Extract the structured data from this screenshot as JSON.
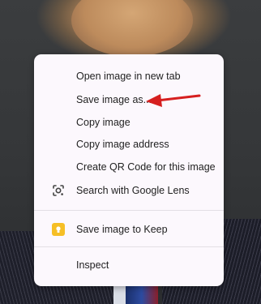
{
  "context_menu": {
    "items": [
      {
        "label": "Open image in new tab"
      },
      {
        "label": "Save image as..."
      },
      {
        "label": "Copy image"
      },
      {
        "label": "Copy image address"
      },
      {
        "label": "Create QR Code for this image"
      },
      {
        "label": "Search with Google Lens",
        "icon": "google-lens-icon"
      },
      {
        "label": "Save image to Keep",
        "icon": "google-keep-icon"
      },
      {
        "label": "Inspect"
      }
    ]
  },
  "annotation": {
    "arrow_color": "#d61f1f",
    "points_to": "Save image as..."
  },
  "colors": {
    "menu_background": "#fcf8fd",
    "keep_yellow": "#f6bf26",
    "text": "#1f1f1f"
  }
}
